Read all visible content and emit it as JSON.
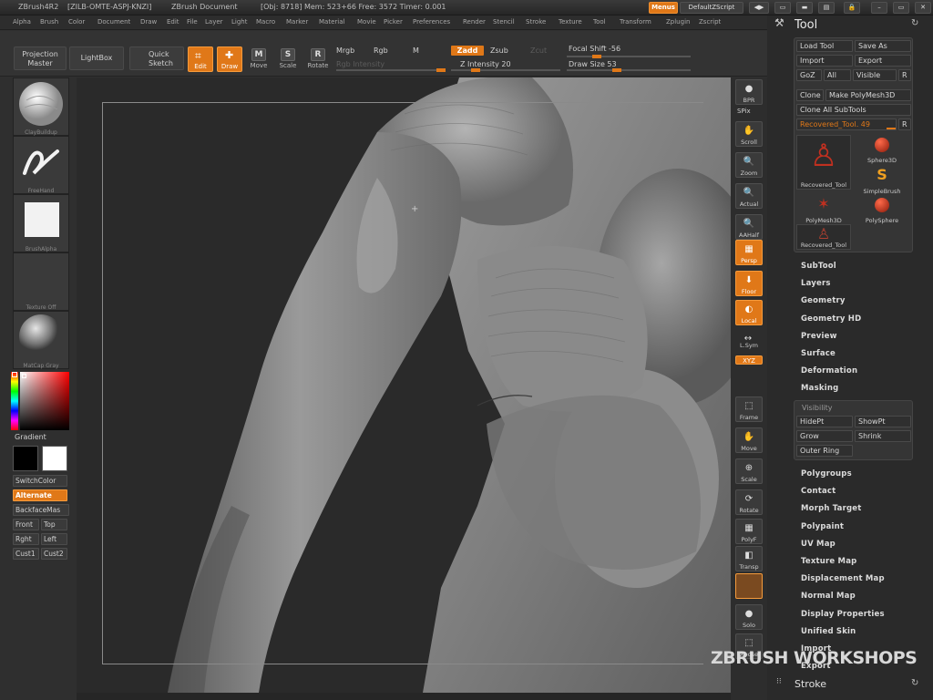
{
  "titlebar": {
    "app": "ZBrush4R2",
    "serial": "[ZILB-OMTE-ASPJ-KNZI]",
    "document": "ZBrush Document",
    "stats": "[Obj: 8718] Mem: 523+66 Free: 3572 Timer: 0.001",
    "menus_btn": "Menus",
    "script_btn": "DefaultZScript"
  },
  "menubar": [
    "Alpha",
    "Brush",
    "Color",
    "Document",
    "Draw",
    "Edit",
    "File",
    "Layer",
    "Light",
    "Macro",
    "Marker",
    "Material",
    "Movie",
    "Picker",
    "Preferences",
    "Render",
    "Stencil",
    "Stroke",
    "Texture",
    "Tool",
    "Transform",
    "Zplugin",
    "Zscript"
  ],
  "shelf": {
    "projection_master": "Projection Master",
    "lightbox": "LightBox",
    "quick_sketch": "Quick Sketch",
    "edit": "Edit",
    "draw": "Draw",
    "move": "Move",
    "scale": "Scale",
    "rotate": "Rotate",
    "mrgb": "Mrgb",
    "rgb": "Rgb",
    "m": "M",
    "rgb_intensity": "Rgb Intensity",
    "zadd": "Zadd",
    "zsub": "Zsub",
    "zcut": "Zcut",
    "z_intensity": "Z Intensity 20",
    "focal_shift": "Focal Shift -56",
    "draw_size": "Draw Size 53",
    "z_intensity_level": 0.2,
    "focal_shift_level": 0.22,
    "draw_size_level": 0.4
  },
  "left": {
    "brush": "ClayBuildup",
    "stroke": "FreeHand",
    "alpha": "BrushAlpha",
    "texture": "Texture Off",
    "material": "MatCap Gray",
    "gradient": "Gradient",
    "switchcolor": "SwitchColor",
    "alternate": "Alternate",
    "backface": "BackfaceMas",
    "front": "Front",
    "top": "Top",
    "right": "Rght",
    "left": "Left",
    "cust1": "Cust1",
    "cust2": "Cust2"
  },
  "rightstrip": [
    {
      "name": "bpr",
      "label": "BPR",
      "glyph": "●",
      "on": false
    },
    {
      "name": "scroll",
      "label": "Scroll",
      "glyph": "✋",
      "on": false
    },
    {
      "name": "zoom",
      "label": "Zoom",
      "glyph": "🔍",
      "on": false
    },
    {
      "name": "actual",
      "label": "Actual",
      "glyph": "🔍",
      "on": false
    },
    {
      "name": "aahalf",
      "label": "AAHalf",
      "glyph": "🔍",
      "on": false
    },
    {
      "name": "persp",
      "label": "Persp",
      "glyph": "▦",
      "on": true
    },
    {
      "name": "floor",
      "label": "Floor",
      "glyph": "⬇",
      "on": true
    },
    {
      "name": "local",
      "label": "Local",
      "glyph": "◐",
      "on": true
    },
    {
      "name": "lsym",
      "label": "L.Sym",
      "glyph": "↔",
      "on": false
    },
    {
      "name": "xyz",
      "label": "XYZ",
      "glyph": "",
      "on": true
    },
    {
      "name": "frame",
      "label": "Frame",
      "glyph": "⬚",
      "on": false
    },
    {
      "name": "move",
      "label": "Move",
      "glyph": "✋",
      "on": false
    },
    {
      "name": "scale",
      "label": "Scale",
      "glyph": "⊕",
      "on": false
    },
    {
      "name": "rotate",
      "label": "Rotate",
      "glyph": "⟳",
      "on": false
    },
    {
      "name": "polyf",
      "label": "PolyF",
      "glyph": "▦",
      "on": false
    },
    {
      "name": "transp",
      "label": "Transp",
      "glyph": "◧",
      "on": false
    },
    {
      "name": "ghost",
      "label": "",
      "glyph": "",
      "on": true
    },
    {
      "name": "solo",
      "label": "Solo",
      "glyph": "●",
      "on": false
    },
    {
      "name": "xpose",
      "label": "Xpose",
      "glyph": "⬚",
      "on": false
    }
  ],
  "spix": "SPix",
  "tool": {
    "title": "Tool",
    "load_tool": "Load Tool",
    "save_as": "Save As",
    "import": "Import",
    "export": "Export",
    "goz": "GoZ",
    "all": "All",
    "visible": "Visible",
    "r": "R",
    "clone": "Clone",
    "make_polymesh": "Make PolyMesh3D",
    "clone_all": "Clone All SubTools",
    "current": "Recovered_Tool. 49",
    "thumbs": [
      {
        "label": "Recovered_Tool",
        "kind": "figure"
      },
      {
        "label": "Sphere3D",
        "kind": "sphere"
      },
      {
        "label": "SimpleBrush",
        "kind": "s"
      },
      {
        "label": "PolyMesh3D",
        "kind": "star"
      },
      {
        "label": "PolySphere",
        "kind": "sphere"
      },
      {
        "label": "Recovered_Tool",
        "kind": "figure2"
      }
    ],
    "sections_top": [
      "SubTool",
      "Layers",
      "Geometry",
      "Geometry HD",
      "Preview",
      "Surface",
      "Deformation",
      "Masking"
    ],
    "visibility": "Visibility",
    "hidept": "HidePt",
    "showpt": "ShowPt",
    "grow": "Grow",
    "shrink": "Shrink",
    "outer_ring": "Outer Ring",
    "sections_bottom": [
      "Polygroups",
      "Contact",
      "Morph Target",
      "Polypaint",
      "UV Map",
      "Texture Map",
      "Displacement Map",
      "Normal Map",
      "Display Properties",
      "Unified Skin",
      "Import",
      "Export"
    ],
    "stroke": "Stroke"
  },
  "watermark": "ZBRUSH WORKSHOPS"
}
